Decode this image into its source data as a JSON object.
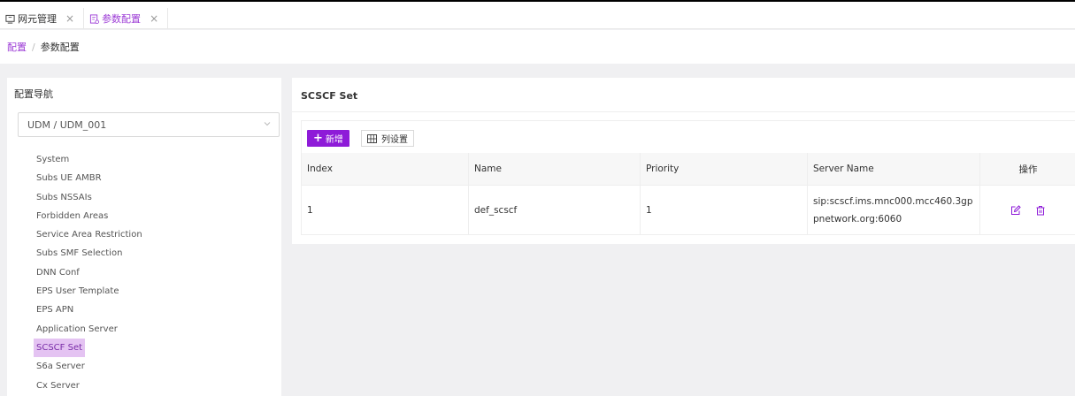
{
  "tabs": [
    {
      "label": "网元管理",
      "close": "×",
      "active": false
    },
    {
      "label": "参数配置",
      "close": "×",
      "active": true
    }
  ],
  "breadcrumb": {
    "root": "配置",
    "separator": "/",
    "current": "参数配置"
  },
  "sidebar": {
    "title": "配置导航",
    "select_value": "UDM / UDM_001",
    "items": [
      "System",
      "Subs UE AMBR",
      "Subs NSSAIs",
      "Forbidden Areas",
      "Service Area Restriction",
      "Subs SMF Selection",
      "DNN Conf",
      "EPS User Template",
      "EPS APN",
      "Application Server",
      "SCSCF Set",
      "S6a Server",
      "Cx Server"
    ],
    "active_item": "SCSCF Set"
  },
  "panel": {
    "title": "SCSCF Set",
    "add_label": "新增",
    "cols_label": "列设置",
    "columns": [
      "Index",
      "Name",
      "Priority",
      "Server Name",
      "操作"
    ],
    "rows": [
      {
        "index": "1",
        "name": "def_scscf",
        "priority": "1",
        "server_name": "sip:scscf.ims.mnc000.mcc460.3gppnetwork.org:6060"
      }
    ]
  },
  "colors": {
    "accent": "#8e1bd8",
    "active_bg": "#e4c3f2",
    "page_bg": "#f0f0f2"
  },
  "icons": {
    "tab1": "monitor-icon",
    "tab2": "settings-doc-icon",
    "edit": "edit-icon",
    "delete": "trash-icon",
    "select": "chevron-down-icon",
    "cols": "table-grid-icon"
  }
}
